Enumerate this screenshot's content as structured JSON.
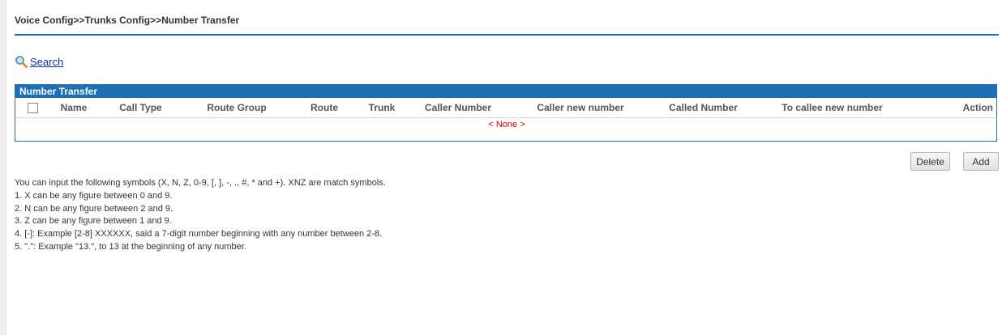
{
  "breadcrumb": "Voice Config>>Trunks Config>>Number Transfer",
  "search": {
    "label": "Search",
    "icon": "search-icon"
  },
  "panel": {
    "title": "Number Transfer",
    "columns": [
      "Name",
      "Call Type",
      "Route Group",
      "Route",
      "Trunk",
      "Caller Number",
      "Caller new number",
      "Called Number",
      "To callee new number",
      "Action"
    ],
    "empty_text": "< None >"
  },
  "buttons": {
    "delete": "Delete",
    "add": "Add"
  },
  "notes": [
    "You can input the following symbols (X, N, Z, 0-9, [, ], -, ., #, * and +). XNZ are match symbols.",
    "1. X can be any figure between 0 and 9.",
    "2. N can be any figure between 2 and 9.",
    "3. Z can be any figure between 1 and 9.",
    "4. [-]: Example [2-8] XXXXXX, said a 7-digit number beginning with any number between 2-8.",
    "5. \".\": Example \"13.\", to 13 at the beginning of any number."
  ],
  "colors": {
    "accent": "#1f6fb5",
    "empty_text": "#cc0000",
    "link": "#0a2fa3"
  }
}
